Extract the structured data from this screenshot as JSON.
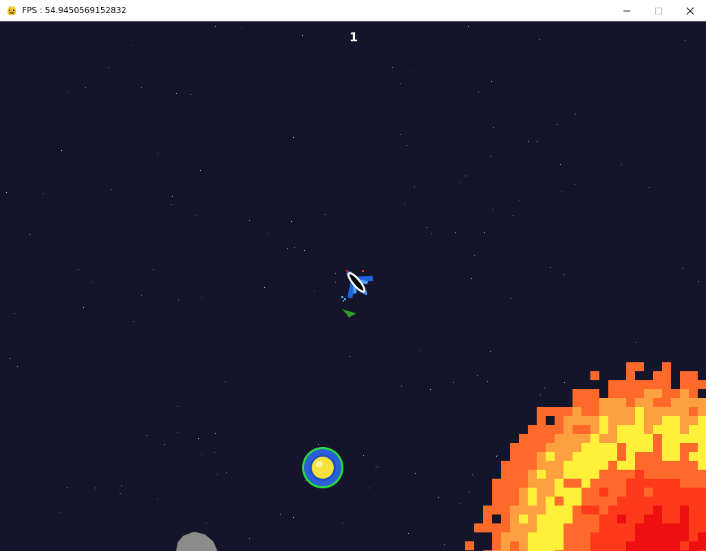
{
  "window": {
    "title": "FPS : 54.9450569152832",
    "controls": {
      "minimize": "minimize",
      "maximize": "maximize",
      "close": "close"
    }
  },
  "hud": {
    "score": "1"
  },
  "colors": {
    "space_background": "#14152a",
    "star": "#c8c8d2",
    "ship_blue": "#1e64dc",
    "ship_white": "#ffffff",
    "thruster_red": "#e63228",
    "enemy_green": "#32a028",
    "powerup_ring_outer": "#28dc3c",
    "powerup_ring_inner": "#2a5fd8",
    "powerup_core": "#f4e23a",
    "sun_outer": "#ff6a2a",
    "sun_mid": "#ffa040",
    "sun_yellow": "#fff03a",
    "sun_inner": "#ff3a1a",
    "sun_core": "#ee1010",
    "asteroid": "#8c8c8c"
  },
  "sprites": {
    "player_ship": "player-ship",
    "enemy_ship": "enemy-ship-green",
    "powerup": "shield-orb-powerup",
    "sun": "pixel-sun",
    "asteroid": "grey-asteroid",
    "app_icon": "pygame-snake-icon"
  }
}
